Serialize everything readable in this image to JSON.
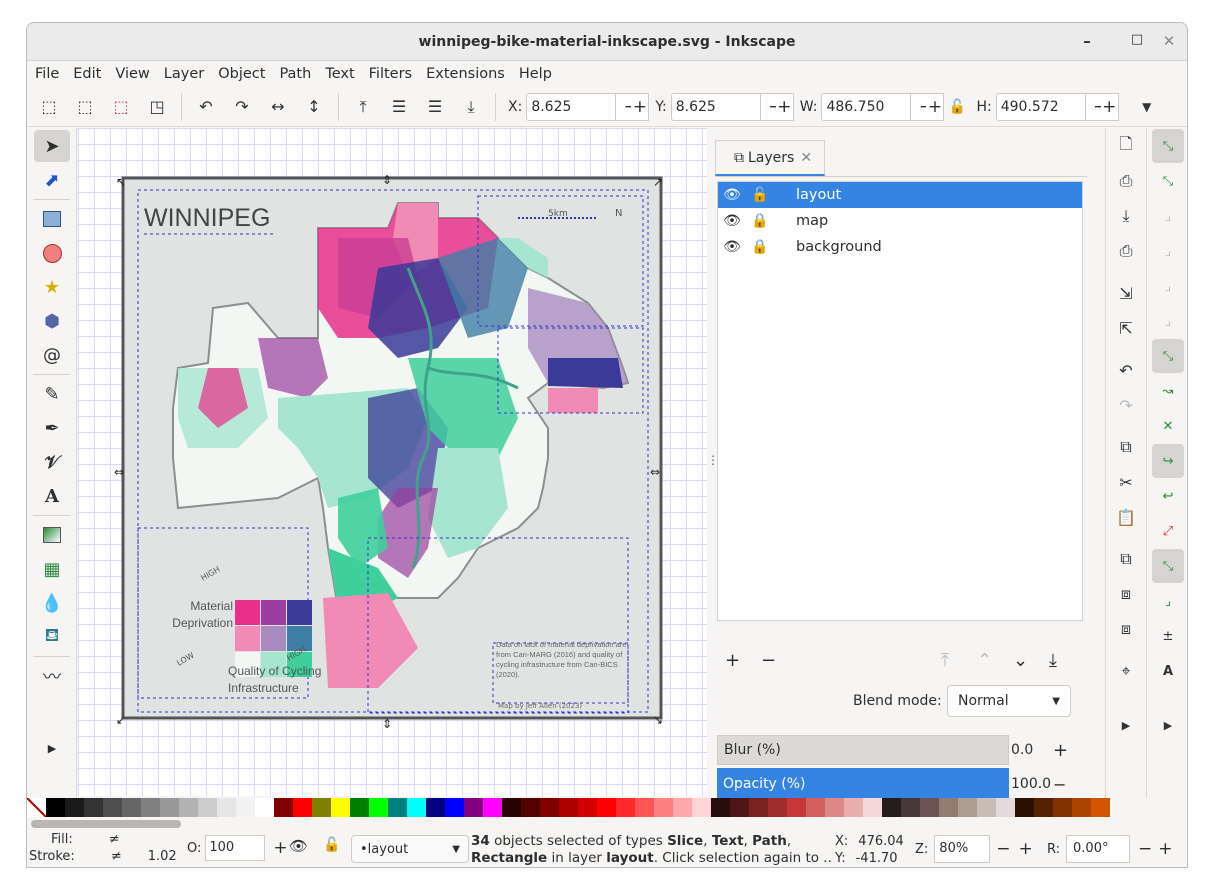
{
  "window": {
    "title": "winnipeg-bike-material-inkscape.svg - Inkscape",
    "minimize": "–",
    "maximize": "□",
    "close": "✕"
  },
  "menu": [
    "File",
    "Edit",
    "View",
    "Layer",
    "Object",
    "Path",
    "Text",
    "Filters",
    "Extensions",
    "Help"
  ],
  "toolbar": {
    "x_label": "X:",
    "x_value": "8.625",
    "y_label": "Y:",
    "y_value": "8.625",
    "w_label": "W:",
    "w_value": "486.750",
    "h_label": "H:",
    "h_value": "490.572",
    "minus": "−",
    "plus": "+"
  },
  "map": {
    "title": "WINNIPEG",
    "legend_high_top": "HIGH",
    "legend_low": "LOW",
    "legend_high_right": "HIGH",
    "legend_y_label": "Material Deprivation",
    "legend_x_label": "Quality of Cycling Infrastructure",
    "source_note": "Data on lack of material deprivation are from Can-MARG (2016) and quality of cycling infrastructure from Can-BICS (2020).",
    "credit": "Map by Jeff Allen (2023)",
    "scale_text": "5km",
    "north_text": "N",
    "legend_colors": [
      "#e8308a",
      "#9a3f9e",
      "#3b3a98",
      "#f28ab6",
      "#a98bbf",
      "#3e7ea5",
      "#f2f7f4",
      "#a6e5cf",
      "#3fcf9c"
    ]
  },
  "layers_panel": {
    "tab_label": "Layers",
    "layers": [
      {
        "name": "layout",
        "visible": true,
        "locked": false,
        "selected": true
      },
      {
        "name": "map",
        "visible": true,
        "locked": true,
        "selected": false
      },
      {
        "name": "background",
        "visible": true,
        "locked": true,
        "selected": false
      }
    ],
    "blend_label": "Blend mode:",
    "blend_value": "Normal",
    "blur_label": "Blur (%)",
    "blur_value": "0.0",
    "opacity_label": "Opacity (%)",
    "opacity_value": "100.0"
  },
  "status": {
    "fill_label": "Fill:",
    "fill_value": "≠",
    "stroke_label": "Stroke:",
    "stroke_value": "≠",
    "stroke_width": "1.02",
    "opacity_label": "O:",
    "opacity_value": "100",
    "layer_value": "•layout",
    "message_prefix": "34",
    "message_line1": " objects selected of types ",
    "type1": "Slice",
    "type2": "Text",
    "type3": "Path",
    "type4": "Rectangle",
    "message_line2a": " in layer ",
    "message_layer": "layout",
    "message_line2b": ". Click selection again to ...",
    "cx_label": "X:",
    "cx_value": "476.04",
    "cy_label": "Y:",
    "cy_value": "-41.70",
    "zoom_label": "Z:",
    "zoom_value": "80%",
    "rot_label": "R:",
    "rot_value": "0.00°"
  },
  "palette": [
    "#ffffff",
    "#000000",
    "#1a1a1a",
    "#333333",
    "#4d4d4d",
    "#666666",
    "#808080",
    "#999999",
    "#b3b3b3",
    "#cccccc",
    "#e6e6e6",
    "#f2f2f2",
    "#ffffff",
    "#800000",
    "#ff0000",
    "#808000",
    "#ffff00",
    "#008000",
    "#00ff00",
    "#008080",
    "#00ffff",
    "#000080",
    "#0000ff",
    "#800080",
    "#ff00ff",
    "#2b0000",
    "#550000",
    "#800000",
    "#aa0000",
    "#d40000",
    "#ff0000",
    "#ff2a2a",
    "#ff5555",
    "#ff8080",
    "#ffaaaa",
    "#ffd5d5",
    "#280b0b",
    "#501616",
    "#782121",
    "#a02c2c",
    "#c83737",
    "#d35f5f",
    "#de8787",
    "#e9afaf",
    "#f4d7d7",
    "#241c1c",
    "#483737",
    "#6c5353",
    "#917c6f",
    "#ac9d93",
    "#c8beb7",
    "#e3dbdb",
    "#2b1100",
    "#552200",
    "#803300",
    "#aa4400",
    "#d45500"
  ]
}
